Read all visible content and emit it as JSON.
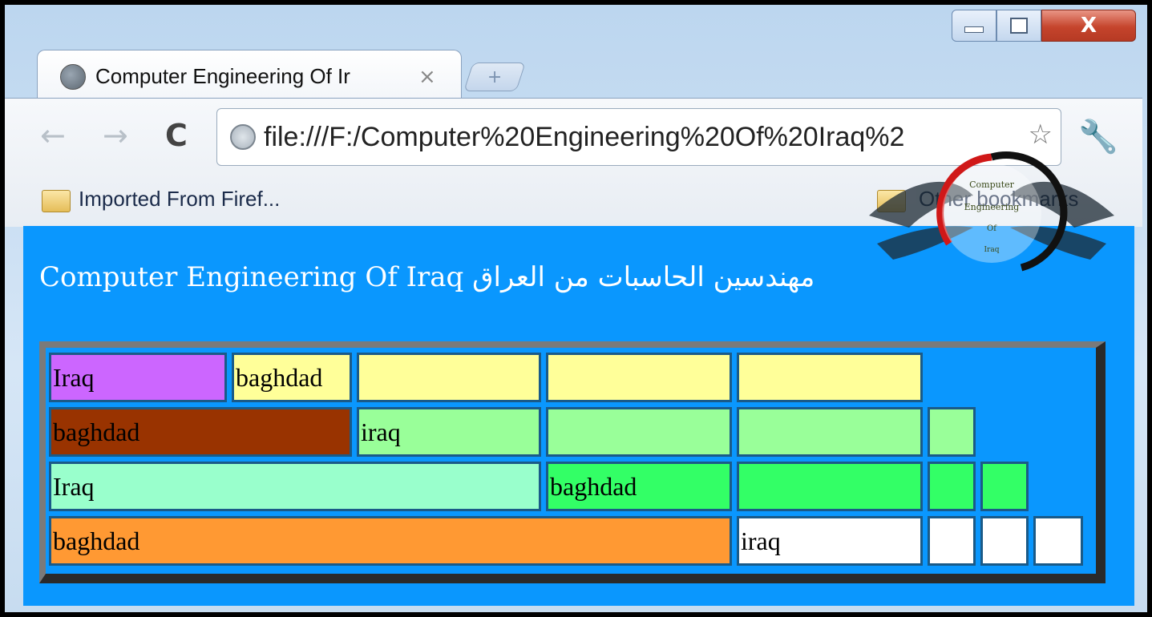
{
  "window": {
    "close_label": "X"
  },
  "tab": {
    "title": "Computer Engineering Of Ir",
    "close_glyph": "×",
    "new_tab_glyph": "+"
  },
  "toolbar": {
    "back_glyph": "←",
    "forward_glyph": "→",
    "reload_glyph": "C",
    "url": "file:///F:/Computer%20Engineering%20Of%20Iraq%2",
    "star_glyph": "☆",
    "wrench_glyph": "🔧"
  },
  "bookmarks": {
    "imported_label": "Imported From Firef...",
    "other_label": "Other bookmarks"
  },
  "page": {
    "heading": "Computer Engineering Of Iraq مهندسين الحاسبات من العراق",
    "background_color": "#0a97fe"
  },
  "logo": {
    "line1": "Computer",
    "line2": "Engineering",
    "line3": "Of",
    "line4": "Iraq"
  },
  "grid": {
    "rows": [
      [
        {
          "text": "Iraq",
          "color": "#cc66ff"
        },
        {
          "text": "baghdad",
          "color": "#ffff99"
        },
        {
          "text": "",
          "color": "#ffff99"
        },
        {
          "text": "",
          "color": "#ffff99"
        },
        {
          "text": "",
          "color": "#ffff99"
        }
      ],
      [
        {
          "text": "baghdad",
          "color": "#993300"
        },
        {
          "text": "iraq",
          "color": "#99ff99"
        },
        {
          "text": "",
          "color": "#99ff99"
        },
        {
          "text": "",
          "color": "#99ff99"
        },
        {
          "text": "",
          "color": "#99ff99"
        }
      ],
      [
        {
          "text": "Iraq",
          "color": "#99ffcc"
        },
        {
          "text": "baghdad",
          "color": "#33ff66"
        },
        {
          "text": "",
          "color": "#33ff66"
        },
        {
          "text": "",
          "color": "#33ff66"
        },
        {
          "text": "",
          "color": "#33ff66"
        }
      ],
      [
        {
          "text": "baghdad",
          "color": "#ff9933"
        },
        {
          "text": "iraq",
          "color": "#ffffff"
        },
        {
          "text": "",
          "color": "#ffffff"
        },
        {
          "text": "",
          "color": "#ffffff"
        },
        {
          "text": "",
          "color": "#ffffff"
        }
      ]
    ]
  }
}
